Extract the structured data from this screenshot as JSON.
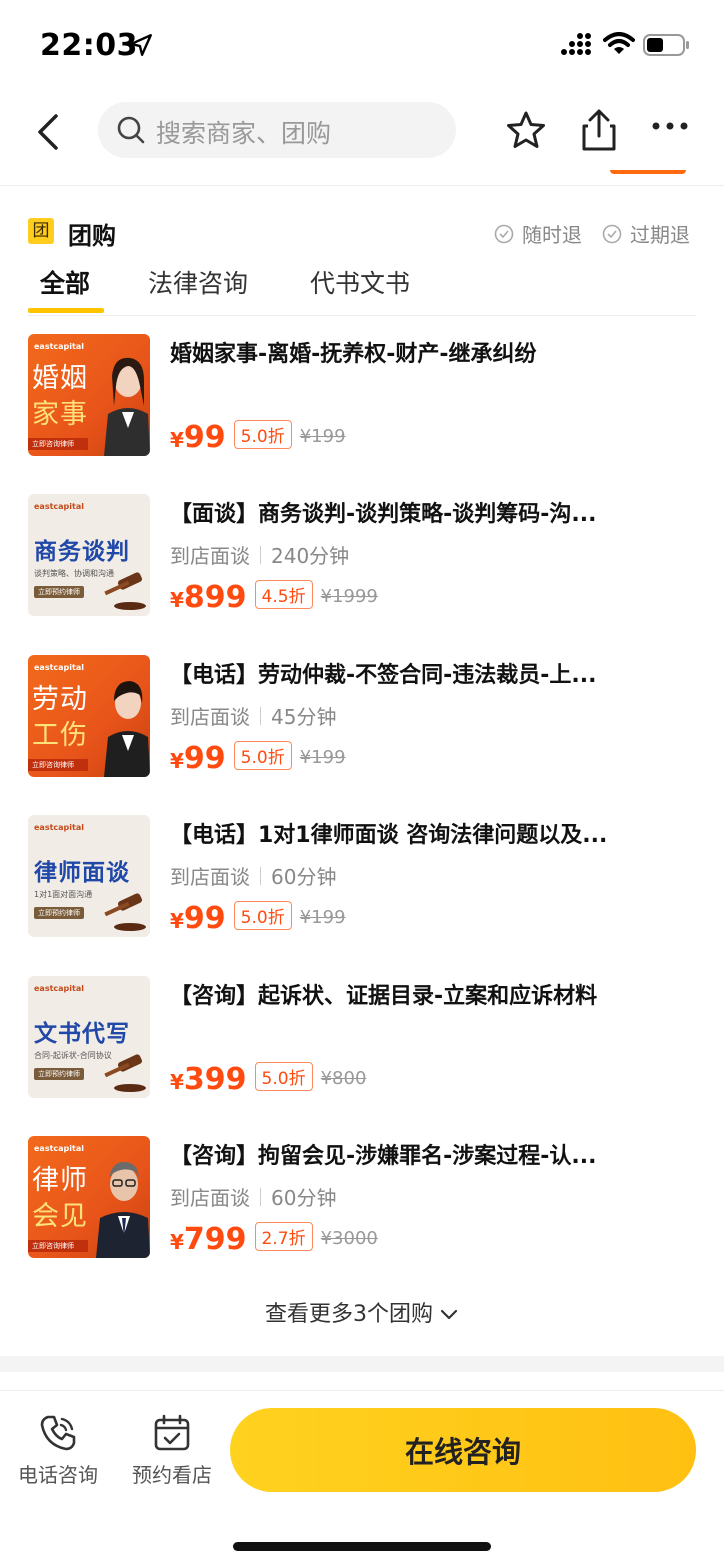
{
  "status_bar": {
    "time": "22:03"
  },
  "nav": {
    "search_placeholder": "搜索商家、团购"
  },
  "section": {
    "badge": "团",
    "title": "团购",
    "guarantee_1": "随时退",
    "guarantee_2": "过期退"
  },
  "tabs": [
    {
      "label": "全部"
    },
    {
      "label": "法律咨询"
    },
    {
      "label": "代书文书"
    }
  ],
  "deals": [
    {
      "title": "婚姻家事-离婚-抚养权-财产-继承纠纷",
      "meta_1": "",
      "meta_2": "",
      "price": "99",
      "discount": "5.0折",
      "original": "¥199",
      "thumb": {
        "logo": "eastcapital",
        "line1": "婚姻",
        "line2": "家事",
        "strip": "立即咨询律师"
      }
    },
    {
      "title": "【面谈】商务谈判-谈判策略-谈判筹码-沟...",
      "meta_1": "到店面谈",
      "meta_2": "240分钟",
      "price": "899",
      "discount": "4.5折",
      "original": "¥1999",
      "thumb": {
        "logo": "eastcapital",
        "main": "商务谈判",
        "sub": "谈判策略、协调和沟通",
        "tag": "立即预约律师"
      }
    },
    {
      "title": "【电话】劳动仲裁-不签合同-违法裁员-上...",
      "meta_1": "到店面谈",
      "meta_2": "45分钟",
      "price": "99",
      "discount": "5.0折",
      "original": "¥199",
      "thumb": {
        "logo": "eastcapital",
        "line1": "劳动",
        "line2": "工伤",
        "strip": "立即咨询律师"
      }
    },
    {
      "title": "【电话】1对1律师面谈 咨询法律问题以及...",
      "meta_1": "到店面谈",
      "meta_2": "60分钟",
      "price": "99",
      "discount": "5.0折",
      "original": "¥199",
      "thumb": {
        "logo": "eastcapital",
        "main": "律师面谈",
        "sub": "1对1面对面沟通",
        "tag": "立即预约律师"
      }
    },
    {
      "title": "【咨询】起诉状、证据目录-立案和应诉材料",
      "meta_1": "",
      "meta_2": "",
      "price": "399",
      "discount": "5.0折",
      "original": "¥800",
      "thumb": {
        "logo": "eastcapital",
        "main": "文书代写",
        "sub": "合同-起诉状-合同协议",
        "tag": "立即预约律师"
      }
    },
    {
      "title": "【咨询】拘留会见-涉嫌罪名-涉案过程-认...",
      "meta_1": "到店面谈",
      "meta_2": "60分钟",
      "price": "799",
      "discount": "2.7折",
      "original": "¥3000",
      "thumb": {
        "logo": "eastcapital",
        "line1": "律师",
        "line2": "会见",
        "strip": "立即咨询律师"
      }
    }
  ],
  "see_more": "查看更多3个团购",
  "currency": "¥",
  "bottom_bar": {
    "phone_label": "电话咨询",
    "store_label": "预约看店",
    "cta_label": "在线咨询"
  },
  "colors": {
    "accent": "#ffc300",
    "price": "#ff4b10"
  }
}
